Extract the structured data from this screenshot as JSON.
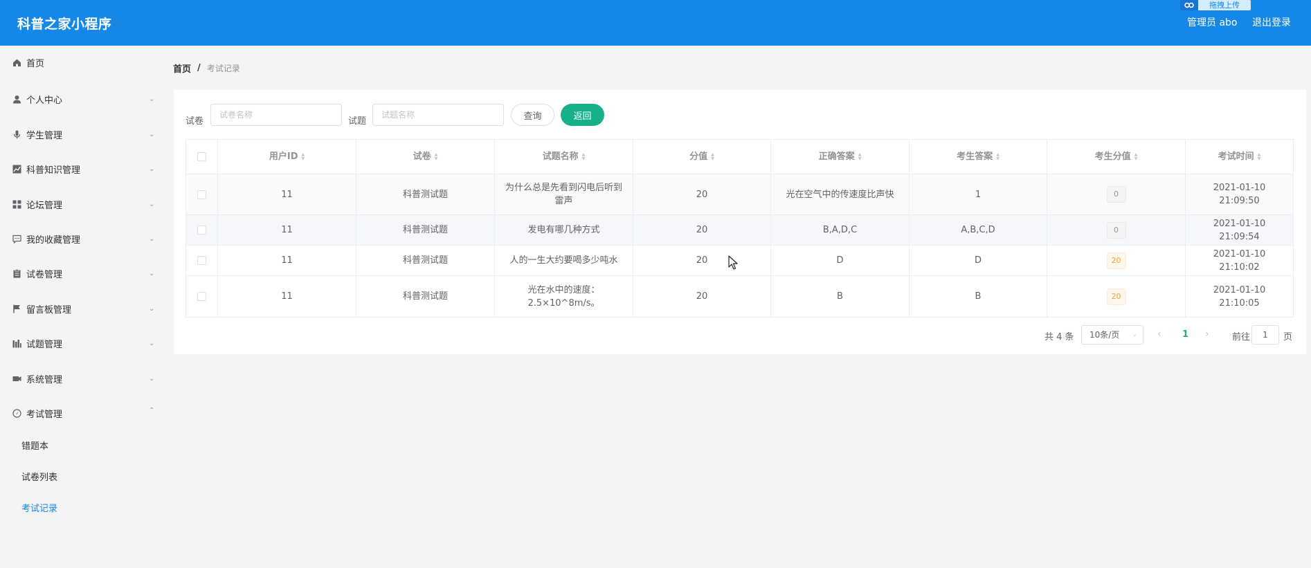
{
  "header": {
    "title": "科普之家小程序",
    "upload_badge_icon": "baidu-paw-icon",
    "upload_badge_text": "拖拽上传",
    "admin_label": "管理员 abo",
    "logout_label": "退出登录",
    "bg_color": "#1587e6"
  },
  "sidebar": {
    "items": [
      {
        "label": "首页",
        "icon": "home-icon",
        "has_arrow": false
      },
      {
        "label": "个人中心",
        "icon": "user-icon",
        "has_arrow": true
      },
      {
        "label": "学生管理",
        "icon": "microphone-icon",
        "has_arrow": true
      },
      {
        "label": "科普知识管理",
        "icon": "chart-icon",
        "has_arrow": true
      },
      {
        "label": "论坛管理",
        "icon": "grid-icon",
        "has_arrow": true
      },
      {
        "label": "我的收藏管理",
        "icon": "message-icon",
        "has_arrow": true
      },
      {
        "label": "试卷管理",
        "icon": "clipboard-icon",
        "has_arrow": true
      },
      {
        "label": "留言板管理",
        "icon": "flag-icon",
        "has_arrow": true
      },
      {
        "label": "试题管理",
        "icon": "bar-chart-icon",
        "has_arrow": true
      },
      {
        "label": "系统管理",
        "icon": "video-icon",
        "has_arrow": true
      },
      {
        "label": "考试管理",
        "icon": "compass-icon",
        "has_arrow": true,
        "expanded": true
      }
    ],
    "subitems": [
      {
        "label": "错题本",
        "active": false
      },
      {
        "label": "试卷列表",
        "active": false
      },
      {
        "label": "考试记录",
        "active": true
      }
    ]
  },
  "breadcrumb": {
    "home": "首页",
    "separator": "/",
    "current": "考试记录"
  },
  "search": {
    "paper_label": "试卷",
    "paper_placeholder": "试卷名称",
    "question_label": "试题",
    "question_placeholder": "试题名称",
    "query_button": "查询",
    "back_button": "返回"
  },
  "table": {
    "columns": [
      "用户ID",
      "试卷",
      "试题名称",
      "分值",
      "正确答案",
      "考生答案",
      "考生分值",
      "考试时间"
    ],
    "rows": [
      {
        "user_id": "11",
        "paper": "科普测试题",
        "question": "为什么总是先看到闪电后听到雷声",
        "score": "20",
        "correct": "光在空气中的传速度比声快",
        "answer": "1",
        "got": "0",
        "time": "2021-01-10 21:09:50"
      },
      {
        "user_id": "11",
        "paper": "科普测试题",
        "question": "发电有哪几种方式",
        "score": "20",
        "correct": "B,A,D,C",
        "answer": "A,B,C,D",
        "got": "0",
        "time": "2021-01-10 21:09:54"
      },
      {
        "user_id": "11",
        "paper": "科普测试题",
        "question": "人的一生大约要喝多少吨水",
        "score": "20",
        "correct": "D",
        "answer": "D",
        "got": "20",
        "time": "2021-01-10 21:10:02"
      },
      {
        "user_id": "11",
        "paper": "科普测试题",
        "question": "光在水中的速度：2.5×10^8m/s。",
        "score": "20",
        "correct": "B",
        "answer": "B",
        "got": "20",
        "time": "2021-01-10 21:10:05"
      }
    ]
  },
  "pagination": {
    "total": "共 4 条",
    "page_size": "10条/页",
    "current_page": "1",
    "goto_label": "前往",
    "goto_value": "1",
    "page_suffix": "页"
  },
  "colors": {
    "accent": "#16b18b",
    "primary": "#1587e6"
  }
}
